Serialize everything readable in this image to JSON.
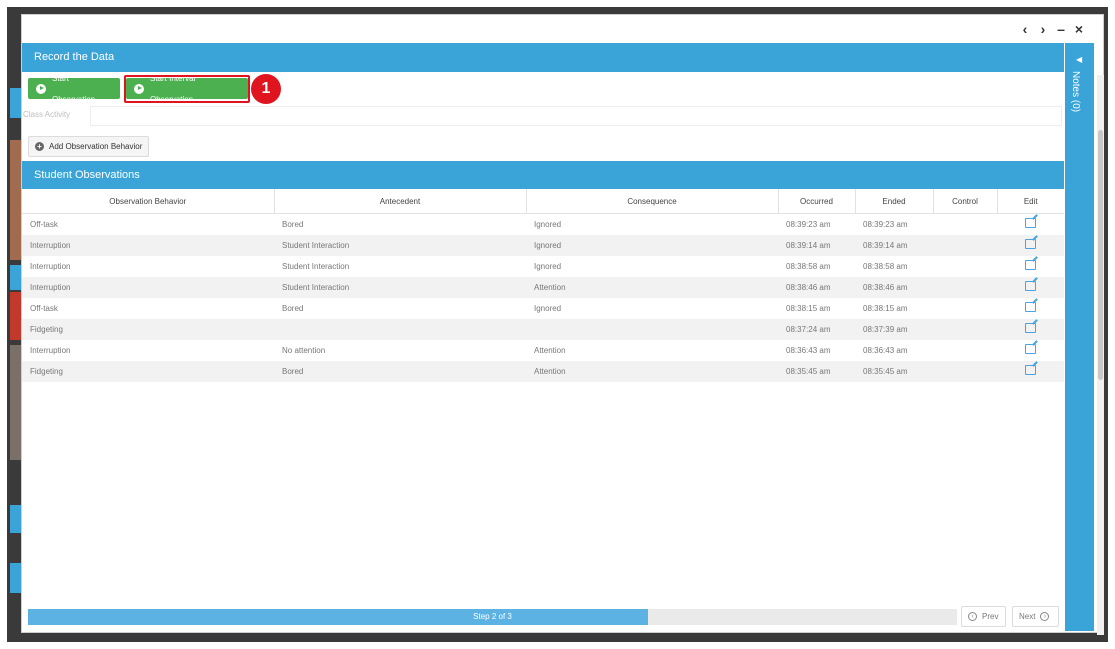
{
  "colors": {
    "accent": "#3aa4d9",
    "green": "#4caf50",
    "highlight": "#e0141e",
    "progress": "#5cb3e3"
  },
  "window_controls": {
    "prev": "‹",
    "next": "›",
    "minimize": "–",
    "close": "×"
  },
  "header": {
    "title": "Record the Data"
  },
  "actions": {
    "start_observation": "Start Observation",
    "start_interval_observation": "Start Interval Observation",
    "callout_number": "1",
    "add_behavior": "Add Observation Behavior"
  },
  "class_activity": {
    "label": "Class Activity",
    "value": ""
  },
  "observations": {
    "title": "Student Observations",
    "columns": [
      "Observation Behavior",
      "Antecedent",
      "Consequence",
      "Occurred",
      "Ended",
      "Control",
      "Edit"
    ],
    "rows": [
      {
        "behavior": "Off-task",
        "antecedent": "Bored",
        "consequence": "Ignored",
        "occurred": "08:39:23 am",
        "ended": "08:39:23 am",
        "control": ""
      },
      {
        "behavior": "Interruption",
        "antecedent": "Student Interaction",
        "consequence": "Ignored",
        "occurred": "08:39:14 am",
        "ended": "08:39:14 am",
        "control": ""
      },
      {
        "behavior": "Interruption",
        "antecedent": "Student Interaction",
        "consequence": "Ignored",
        "occurred": "08:38:58 am",
        "ended": "08:38:58 am",
        "control": ""
      },
      {
        "behavior": "Interruption",
        "antecedent": "Student Interaction",
        "consequence": "Attention",
        "occurred": "08:38:46 am",
        "ended": "08:38:46 am",
        "control": ""
      },
      {
        "behavior": "Off-task",
        "antecedent": "Bored",
        "consequence": "Ignored",
        "occurred": "08:38:15 am",
        "ended": "08:38:15 am",
        "control": ""
      },
      {
        "behavior": "Fidgeting",
        "antecedent": "",
        "consequence": "",
        "occurred": "08:37:24 am",
        "ended": "08:37:39 am",
        "control": ""
      },
      {
        "behavior": "Interruption",
        "antecedent": "No attention",
        "consequence": "Attention",
        "occurred": "08:36:43 am",
        "ended": "08:36:43 am",
        "control": ""
      },
      {
        "behavior": "Fidgeting",
        "antecedent": "Bored",
        "consequence": "Attention",
        "occurred": "08:35:45 am",
        "ended": "08:35:45 am",
        "control": ""
      }
    ]
  },
  "notes": {
    "label": "Notes (0)",
    "chevron": "◀"
  },
  "progress": {
    "label": "Step 2 of 3",
    "fraction": 0.667
  },
  "nav": {
    "prev": "Prev",
    "next": "Next"
  }
}
